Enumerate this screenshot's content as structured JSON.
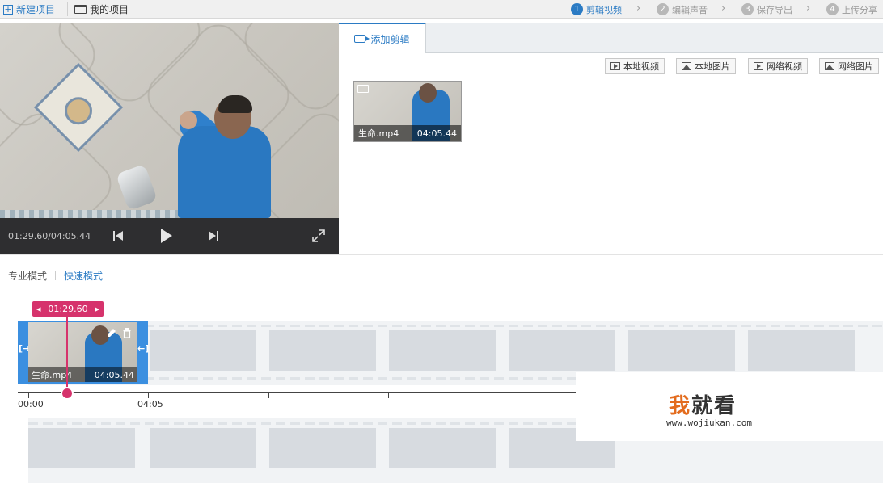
{
  "topbar": {
    "new_project": "新建项目",
    "my_projects": "我的项目",
    "steps": [
      {
        "num": "1",
        "label": "剪辑视频",
        "active": true
      },
      {
        "num": "2",
        "label": "编辑声音",
        "active": false
      },
      {
        "num": "3",
        "label": "保存导出",
        "active": false
      },
      {
        "num": "4",
        "label": "上传分享",
        "active": false
      }
    ]
  },
  "player": {
    "time_readout": "01:29.60/04:05.44"
  },
  "right_panel": {
    "tab_label": "添加剪辑",
    "import_buttons": [
      "本地视频",
      "本地图片",
      "网络视频",
      "网络图片"
    ],
    "clip": {
      "name": "生命.mp4",
      "duration": "04:05.44"
    }
  },
  "modes": {
    "pro": "专业模式",
    "quick": "快速模式"
  },
  "timeline": {
    "playhead_time": "01:29.60",
    "clip": {
      "name": "生命.mp4",
      "duration": "04:05.44"
    },
    "ticks": [
      "00:00",
      "04:05"
    ]
  },
  "watermark": {
    "title_first": "我",
    "title_rest": "就看",
    "url": "www.wojiukan.com"
  },
  "colors": {
    "accent": "#2b7bc4",
    "playhead": "#d6336c",
    "player_bar": "#2e2e30"
  }
}
